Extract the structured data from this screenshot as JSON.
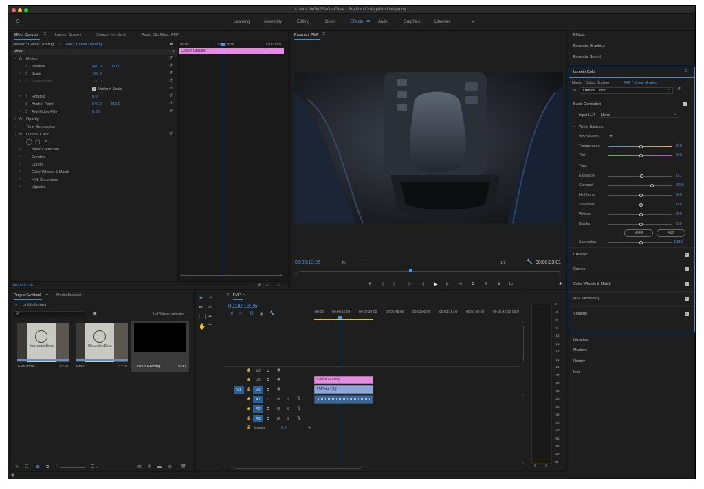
{
  "window": {
    "title": "/Users/10650760/OneDrive - Bradford College/Untitled.prproj *"
  },
  "workspaces": {
    "items": [
      "Learning",
      "Assembly",
      "Editing",
      "Color",
      "Effects",
      "Audio",
      "Graphics",
      "Libraries"
    ],
    "active": "Effects",
    "more": "»"
  },
  "effect_controls": {
    "tabs": [
      "Effect Controls",
      "Lumetri Scopes",
      "Source: (no clips)",
      "Audio Clip Mixer: FMP"
    ],
    "clip_path": "Master * Colour Grading",
    "clip_name": "FMP * Colour Grading",
    "section": "Video",
    "motion": "Motion",
    "position": "Position",
    "position_x": "640.0",
    "position_y": "360.0",
    "scale": "Scale",
    "scale_val": "100.0",
    "scale_width": "Scale Width",
    "scale_width_val": "100.0",
    "uniform_scale": "Uniform Scale",
    "rotation": "Rotation",
    "rotation_val": "0.0",
    "anchor": "Anchor Point",
    "anchor_x": "640.0",
    "anchor_y": "360.0",
    "antiflicker": "Anti-flicker Filter",
    "antiflicker_val": "0.00",
    "opacity": "Opacity",
    "time_remap": "Time Remapping",
    "lumetri": "Lumetri Color",
    "subs": [
      "Basic Correction",
      "Creative",
      "Curves",
      "Color Wheels & Match",
      "HSL Secondary",
      "Vignette"
    ],
    "time_labels": [
      "00:00",
      "00:00:15:00",
      "00:00:30:0"
    ],
    "clip_bar": "Colour Grading",
    "timecode": "00:00:13:26"
  },
  "program": {
    "title": "Program: FMP",
    "timecode": "00:00:13:26",
    "fit": "Fit",
    "resolution": "1/2",
    "duration": "00:00:33:01"
  },
  "project": {
    "tabs": [
      "Project: Untitled",
      "Media Browser"
    ],
    "file": "Untitled.prproj",
    "selection": "1 of 3 items selected",
    "items": [
      {
        "name": "FMP.mp4",
        "dur": "33:01"
      },
      {
        "name": "FMP",
        "dur": "33:01"
      },
      {
        "name": "Colour Grading",
        "dur": "5:00"
      }
    ],
    "thumb_text": "Mercedes-Benz"
  },
  "timeline": {
    "title": "FMP",
    "timecode": "00:00:13:26",
    "ruler": [
      ":00:00",
      "00:00:15:00",
      "00:00:30:00",
      "00:00:45:00",
      "00:01:00:00",
      "00:01:15:00",
      "00:01:30:00",
      "00:01:45:00",
      "00:0"
    ],
    "tracks": [
      "V3",
      "V2",
      "V1",
      "A1",
      "A2",
      "A3"
    ],
    "source_v": "V1",
    "source_a": "A1",
    "master": "Master",
    "master_val": "0.0",
    "clips": {
      "adjustment": "Colour Grading",
      "video": "FMP.mp4 [V]"
    }
  },
  "meter": {
    "scale": [
      "0",
      "-3",
      "-6",
      "-9",
      "-12",
      "-15",
      "-18",
      "-21",
      "-24",
      "-27",
      "-30",
      "-33",
      "-36",
      "-39",
      "-42",
      "-45",
      "-48",
      "-51",
      "-54",
      "-57",
      "dB"
    ]
  },
  "right": {
    "top": [
      "Effects",
      "Essential Graphics",
      "Essential Sound"
    ],
    "lumetri": "Lumetri Color",
    "clip_path": "Master * Colour Grading",
    "clip_name": "FMP * Colour Grading",
    "effect": "Lumetri Color",
    "basic": "Basic Correction",
    "input_lut": "Input LUT",
    "lut_val": "None",
    "wb": "White Balance",
    "wb_selector": "WB Selector",
    "temperature": "Temperature",
    "temperature_val": "0.0",
    "tint": "Tint",
    "tint_val": "0.0",
    "tone": "Tone",
    "exposure": "Exposure",
    "exposure_val": "0.1",
    "contrast": "Contrast",
    "contrast_val": "34.8",
    "highlights": "Highlights",
    "highlights_val": "0.0",
    "shadows": "Shadows",
    "shadows_val": "0.0",
    "whites": "Whites",
    "whites_val": "0.0",
    "blacks": "Blacks",
    "blacks_val": "0.0",
    "reset": "Reset",
    "auto": "Auto",
    "saturation": "Saturation",
    "saturation_val": "100.0",
    "sections": [
      "Creative",
      "Curves",
      "Color Wheels & Match",
      "HSL Secondary",
      "Vignette"
    ],
    "bottom": [
      "Libraries",
      "Markers",
      "History",
      "Info"
    ]
  },
  "colors": {
    "accent": "#3b8bd6",
    "value": "#4f95e3",
    "adjustment_clip": "#e48ce0",
    "video_clip": "#8fa7d8",
    "audio_clip": "#3e6690"
  }
}
